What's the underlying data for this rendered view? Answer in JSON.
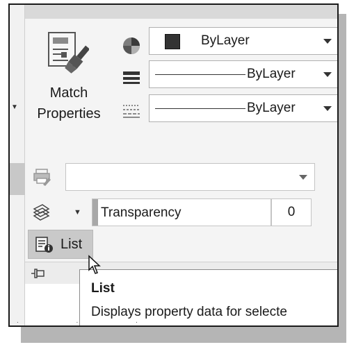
{
  "match_properties": {
    "label_line1": "Match",
    "label_line2": "Properties",
    "icon": "match-properties-brush-icon"
  },
  "properties": {
    "color": {
      "icon": "color-wheel-icon",
      "value": "ByLayer",
      "swatch_color": "#333333"
    },
    "lineweight": {
      "icon": "lineweight-icon",
      "value": "ByLayer"
    },
    "linetype": {
      "icon": "linetype-icon",
      "value": "ByLayer"
    },
    "plot_style": {
      "icon": "plot-style-icon",
      "value": ""
    },
    "transparency": {
      "icon": "transparency-icon",
      "label": "Transparency",
      "value": "0"
    }
  },
  "list_button": {
    "label": "List",
    "icon": "list-info-icon"
  },
  "tooltip": {
    "title": "List",
    "description": "Displays property data for selecte"
  },
  "colors": {
    "panel_bg": "#f4f4f4",
    "button_pressed": "#c9c9c9",
    "tooltip_bg": "#ffffff"
  }
}
